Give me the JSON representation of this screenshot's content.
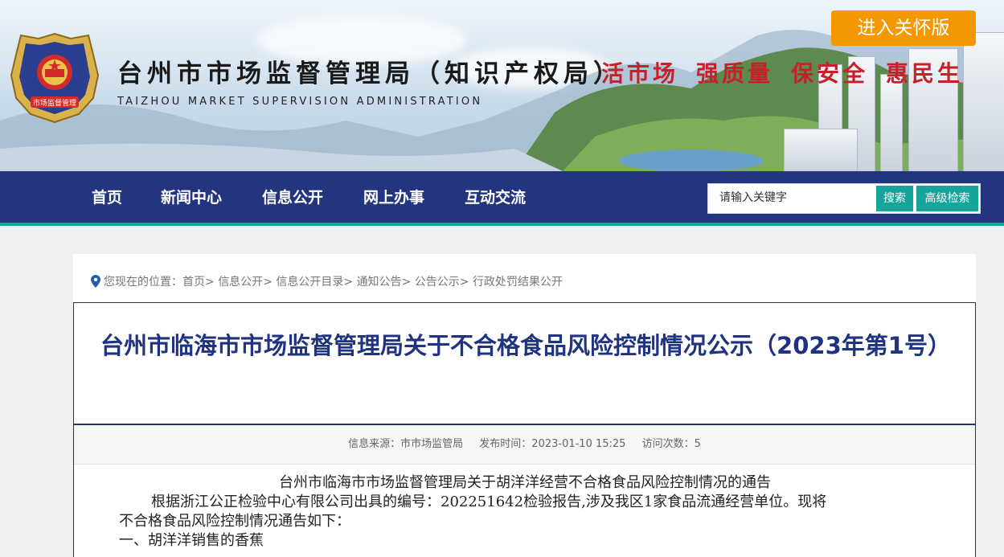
{
  "header": {
    "site_title": "台州市市场监督管理局（知识产权局）",
    "site_subtitle": "TAIZHOU MARKET SUPERVISION ADMINISTRATION",
    "emblem_text": "市场监督管理",
    "slogans": [
      "活市场",
      "强质量",
      "保安全",
      "惠民生"
    ],
    "care_button": "进入关怀版"
  },
  "nav": {
    "items": [
      "首页",
      "新闻中心",
      "信息公开",
      "网上办事",
      "互动交流"
    ],
    "search_placeholder": "请输入关键字",
    "search_button": "搜索",
    "advanced_button": "高级检索"
  },
  "breadcrumb": {
    "prefix": "您现在的位置：",
    "items": [
      "首页",
      "信息公开",
      "信息公开目录",
      "通知公告",
      "公告公示",
      "行政处罚结果公开"
    ]
  },
  "article": {
    "title": "台州市临海市市场监督管理局关于不合格食品风险控制情况公示（2023年第1号）",
    "meta": {
      "source_label": "信息来源：",
      "source": "市市场监管局",
      "date_label": "发布时间：",
      "date": "2023-01-10 15:25",
      "views_label": "访问次数：",
      "views": "5"
    },
    "body": {
      "line1": "台州市临海市市场监督管理局关于胡洋洋经营不合格食品风险控制情况的通告",
      "line2": "根据浙江公正检验中心有限公司出具的编号：202251642检验报告,涉及我区1家食品流通经营单位。现将",
      "line3": "不合格食品风险控制情况通告如下：",
      "line4": "一、胡洋洋销售的香蕉"
    }
  },
  "colors": {
    "nav_bg": "#24357f",
    "accent_teal": "#17a49b",
    "care_orange": "#f39800",
    "slogan_red": "#c8202a",
    "title_blue": "#1f3380"
  }
}
